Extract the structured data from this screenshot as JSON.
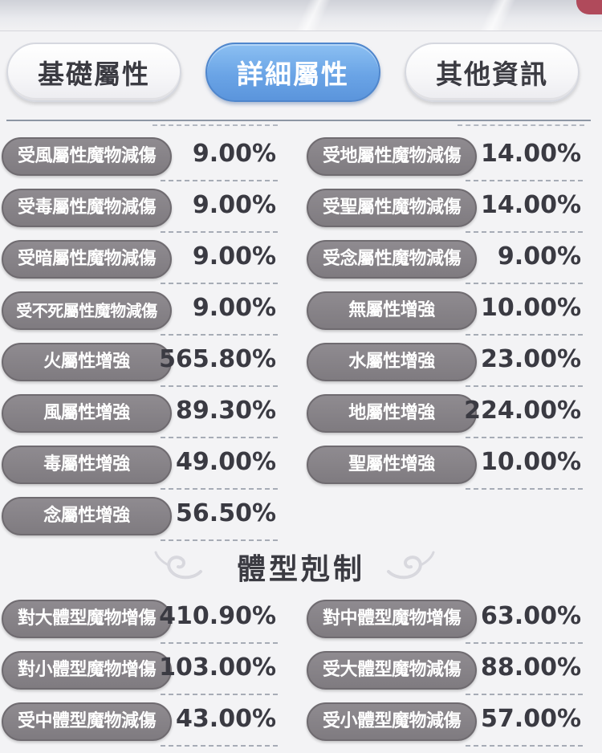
{
  "tabs": [
    "基礎屬性",
    "詳細屬性",
    "其他資訊"
  ],
  "attributes": [
    {
      "label": "受風屬性魔物減傷",
      "value": "9.00%"
    },
    {
      "label": "受地屬性魔物減傷",
      "value": "14.00%"
    },
    {
      "label": "受毒屬性魔物減傷",
      "value": "9.00%"
    },
    {
      "label": "受聖屬性魔物減傷",
      "value": "14.00%"
    },
    {
      "label": "受暗屬性魔物減傷",
      "value": "9.00%"
    },
    {
      "label": "受念屬性魔物減傷",
      "value": "9.00%"
    },
    {
      "label": "受不死屬性魔物減傷",
      "value": "9.00%"
    },
    {
      "label": "無屬性增強",
      "value": "10.00%"
    },
    {
      "label": "火屬性增強",
      "value": "565.80%"
    },
    {
      "label": "水屬性增強",
      "value": "23.00%"
    },
    {
      "label": "風屬性增強",
      "value": "89.30%"
    },
    {
      "label": "地屬性增強",
      "value": "224.00%"
    },
    {
      "label": "毒屬性增強",
      "value": "49.00%"
    },
    {
      "label": "聖屬性增強",
      "value": "10.00%"
    },
    {
      "label": "念屬性增強",
      "value": "56.50%"
    }
  ],
  "section_title": "體型剋制",
  "size_stats": [
    {
      "label": "對大體型魔物增傷",
      "value": "410.90%"
    },
    {
      "label": "對中體型魔物增傷",
      "value": "63.00%"
    },
    {
      "label": "對小體型魔物增傷",
      "value": "103.00%"
    },
    {
      "label": "受大體型魔物減傷",
      "value": "88.00%"
    },
    {
      "label": "受中體型魔物減傷",
      "value": "43.00%"
    },
    {
      "label": "受小體型魔物減傷",
      "value": "57.00%"
    }
  ]
}
